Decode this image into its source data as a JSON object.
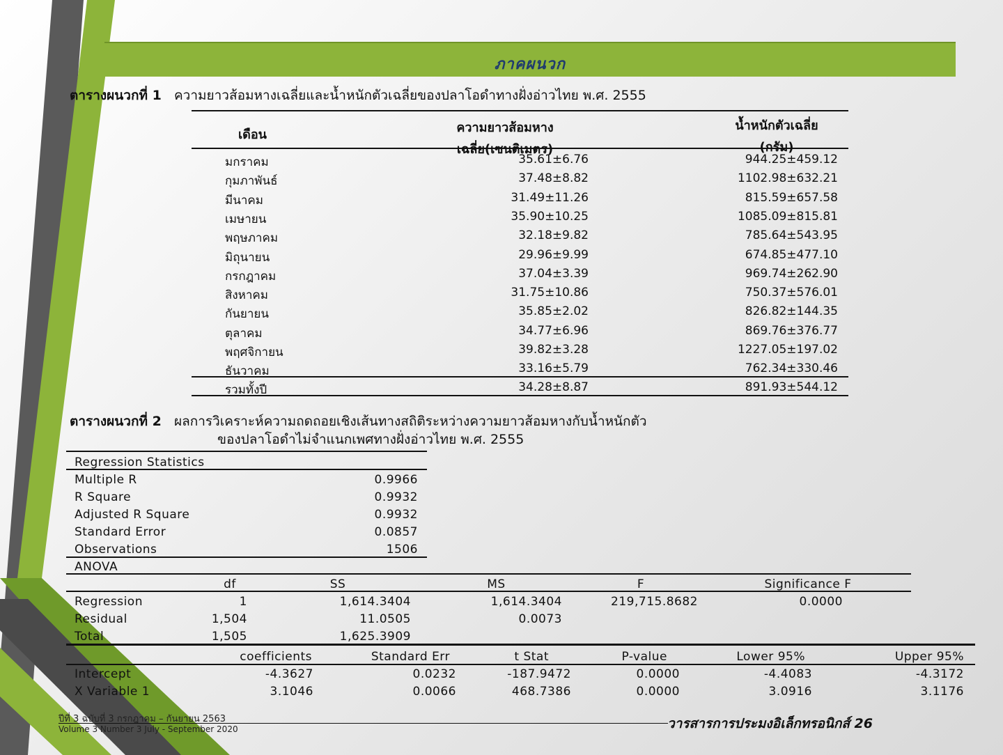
{
  "banner_title": "ภาคผนวก",
  "table1": {
    "caption_label": "ตารางผนวกที่ 1",
    "caption_text": "ความยาวส้อมหางเฉลี่ยและน้ำหนักตัวเฉลี่ยของปลาโอดำทางฝั่งอ่าวไทย พ.ศ. 2555",
    "headers": {
      "month": "เดือน",
      "length_line1": "ความยาวส้อมหาง",
      "length_line2": "เฉลี่ย(เซนติเมตร)",
      "weight_line1": "น้ำหนักตัวเฉลี่ย",
      "weight_line2": "(กรัม)"
    },
    "rows": [
      {
        "month": "มกราคม",
        "length": "35.61±6.76",
        "weight": "944.25±459.12"
      },
      {
        "month": "กุมภาพันธ์",
        "length": "37.48±8.82",
        "weight": "1102.98±632.21"
      },
      {
        "month": "มีนาคม",
        "length": "31.49±11.26",
        "weight": "815.59±657.58"
      },
      {
        "month": "เมษายน",
        "length": "35.90±10.25",
        "weight": "1085.09±815.81"
      },
      {
        "month": "พฤษภาคม",
        "length": "32.18±9.82",
        "weight": "785.64±543.95"
      },
      {
        "month": "มิถุนายน",
        "length": "29.96±9.99",
        "weight": "674.85±477.10"
      },
      {
        "month": "กรกฎาคม",
        "length": "37.04±3.39",
        "weight": "969.74±262.90"
      },
      {
        "month": "สิงหาคม",
        "length": "31.75±10.86",
        "weight": "750.37±576.01"
      },
      {
        "month": "กันยายน",
        "length": "35.85±2.02",
        "weight": "826.82±144.35"
      },
      {
        "month": "ตุลาคม",
        "length": "34.77±6.96",
        "weight": "869.76±376.77"
      },
      {
        "month": "พฤศจิกายน",
        "length": "39.82±3.28",
        "weight": "1227.05±197.02"
      },
      {
        "month": "ธันวาคม",
        "length": "33.16±5.79",
        "weight": "762.34±330.46"
      }
    ],
    "total": {
      "month": "รวมทั้งปี",
      "length": "34.28±8.87",
      "weight": "891.93±544.12"
    }
  },
  "table2": {
    "caption_label": "ตารางผนวกที่ 2",
    "caption_line1": "ผลการวิเคราะห์ความถดถอยเชิงเส้นทางสถิติระหว่างความยาวส้อมหางกับน้ำหนักตัว",
    "caption_line2": "ของปลาโอดำไม่จำแนกเพศทางฝั่งอ่าวไทย พ.ศ. 2555",
    "regression_title": "Regression Statistics",
    "regression_stats": [
      {
        "label": "Multiple R",
        "value": "0.9966"
      },
      {
        "label": "R Square",
        "value": "0.9932"
      },
      {
        "label": "Adjusted R Square",
        "value": "0.9932"
      },
      {
        "label": "Standard Error",
        "value": "0.0857"
      },
      {
        "label": "Observations",
        "value": "1506"
      }
    ],
    "anova_title": "ANOVA",
    "anova_headers": {
      "df": "df",
      "ss": "SS",
      "ms": "MS",
      "f": "F",
      "sig": "Significance F"
    },
    "anova_rows": [
      {
        "label": "Regression",
        "df": "1",
        "ss": "1,614.3404",
        "ms": "1,614.3404",
        "f": "219,715.8682",
        "sig": "0.0000"
      },
      {
        "label": "Residual",
        "df": "1,504",
        "ss": "11.0505",
        "ms": "0.0073",
        "f": "",
        "sig": ""
      },
      {
        "label": "Total",
        "df": "1,505",
        "ss": "1,625.3909",
        "ms": "",
        "f": "",
        "sig": ""
      }
    ],
    "coef_headers": {
      "coef": "coefficients",
      "se": "Standard Err",
      "t": "t Stat",
      "p": "P-value",
      "lower": "Lower 95%",
      "upper": "Upper 95%"
    },
    "coef_rows": [
      {
        "label": "Intercept",
        "coef": "-4.3627",
        "se": "0.0232",
        "t": "-187.9472",
        "p": "0.0000",
        "lower": "-4.4083",
        "upper": "-4.3172"
      },
      {
        "label": "X Variable 1",
        "coef": "3.1046",
        "se": "0.0066",
        "t": "468.7386",
        "p": "0.0000",
        "lower": "3.0916",
        "upper": "3.1176"
      }
    ]
  },
  "footer": {
    "issue_thai": "ปีที่ 3 ฉบับที่ 3 กรกฎาคม – กันยายน 2563",
    "issue_en": "Volume 3 Number 3 July - September 2020",
    "journal": "วารสารการประมงอิเล็กทรอนิกส์ 26"
  },
  "colors": {
    "accent_green": "#8db43a",
    "dark_gray": "#555555",
    "title_blue": "#1f3b6e"
  }
}
